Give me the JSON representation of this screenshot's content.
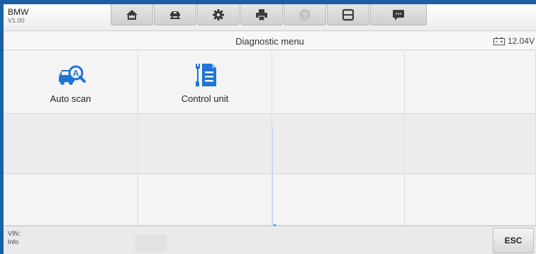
{
  "header": {
    "vehicle_make": "BMW",
    "version": "V1.00",
    "toolbar_buttons": [
      {
        "icon": "home-icon"
      },
      {
        "icon": "vehicle-lift-icon"
      },
      {
        "icon": "gear-icon"
      },
      {
        "icon": "printer-icon"
      },
      {
        "icon": "help-icon"
      },
      {
        "icon": "save-icon"
      },
      {
        "icon": "message-icon"
      }
    ]
  },
  "titlebar": {
    "title": "Diagnostic menu",
    "battery_voltage": "12.04V"
  },
  "menu": {
    "items": [
      {
        "label": "Auto scan",
        "icon": "auto-scan-icon"
      },
      {
        "label": "Control unit",
        "icon": "control-unit-icon"
      }
    ]
  },
  "footer": {
    "vin_label": "VIN:",
    "info_label": "Info",
    "esc_label": "ESC"
  },
  "colors": {
    "frame": "#1d5fa6",
    "icon_blue": "#1f74d6"
  }
}
